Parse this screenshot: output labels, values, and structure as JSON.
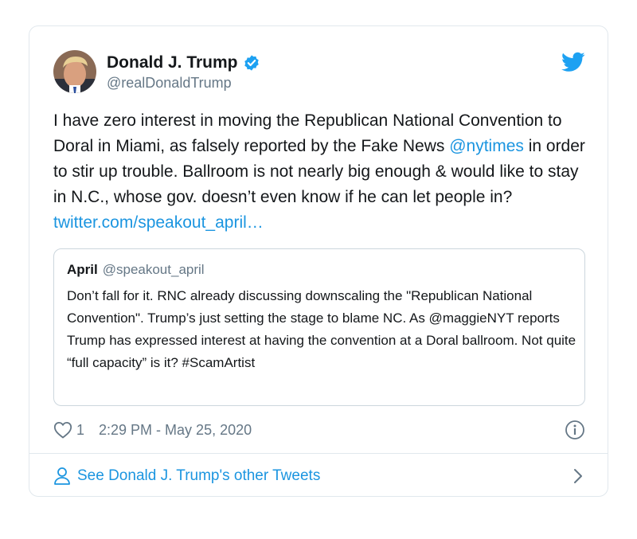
{
  "author": {
    "display_name": "Donald J. Trump",
    "handle": "@realDonaldTrump",
    "verified": true,
    "avatar_icon": "avatar-photo"
  },
  "tweet": {
    "text_part1": "I have zero interest in moving the Republican National Convention to Doral in Miami, as falsely reported by the Fake News ",
    "mention": "@nytimes",
    "text_part2": " in order to stir up trouble. Ballroom is not nearly big enough & would like to stay in N.C., whose gov. doesn’t even know if he can let people in? ",
    "link": "twitter.com/speakout_april…"
  },
  "quoted_tweet": {
    "name": "April",
    "handle": "@speakout_april",
    "text": "Don’t fall for it. RNC already discussing downscaling the \"Republican National Convention\". Trump’s just setting the stage to blame NC. As @maggieNYT reports Trump has expressed interest at having the convention at a Doral ballroom. Not quite “full capacity” is it? #ScamArtist"
  },
  "meta": {
    "like_count": "1",
    "timestamp": "2:29 PM - May 25, 2020"
  },
  "footer": {
    "label": "See Donald J. Trump's other Tweets"
  },
  "colors": {
    "link": "#1b95e0",
    "secondary_text": "#657786",
    "border": "#e1e8ed",
    "verified": "#1da1f2"
  },
  "icons": [
    "verified-badge-icon",
    "twitter-bird-icon",
    "heart-icon",
    "info-icon",
    "person-icon",
    "chevron-right-icon"
  ]
}
